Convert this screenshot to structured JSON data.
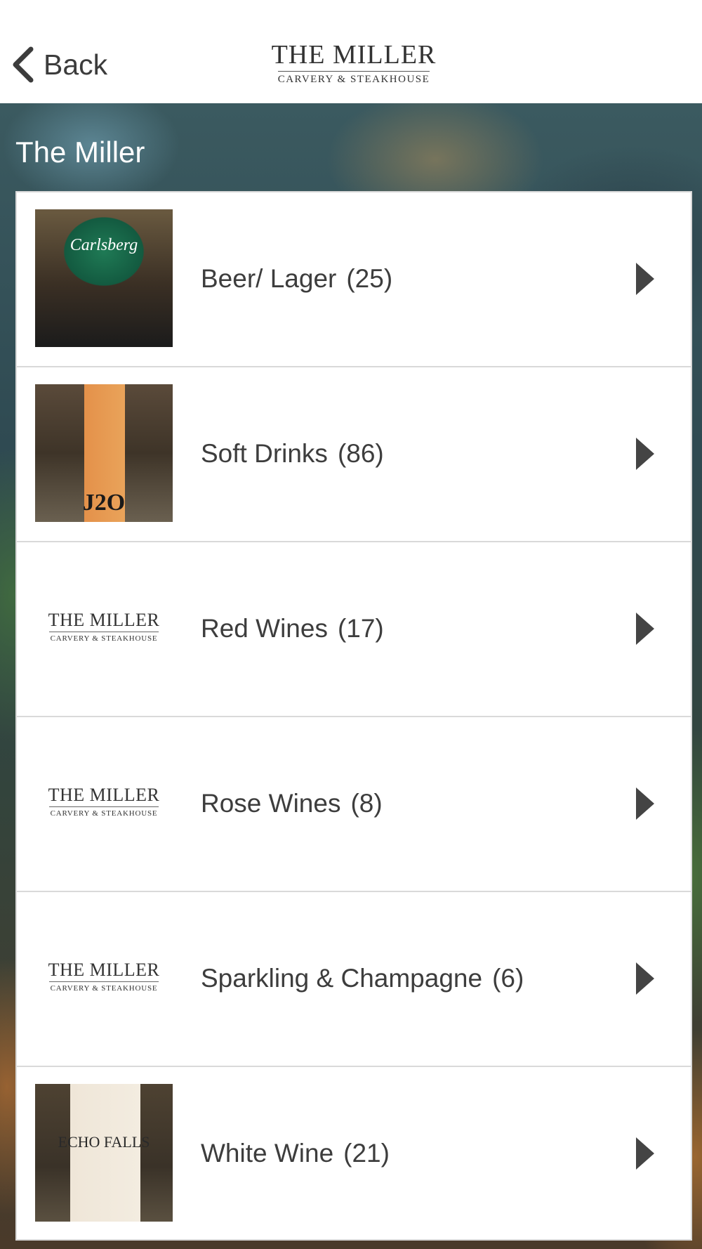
{
  "header": {
    "back_label": "Back",
    "logo_title": "THE MILLER",
    "logo_subtitle": "CARVERY & STEAKHOUSE"
  },
  "section_title": "The Miller",
  "categories": [
    {
      "name": "Beer/ Lager",
      "count": "(25)",
      "thumbnail": "photo-carlsberg-tap"
    },
    {
      "name": "Soft Drinks",
      "count": "(86)",
      "thumbnail": "photo-j2o-bottle"
    },
    {
      "name": "Red Wines",
      "count": "(17)",
      "thumbnail": "logo"
    },
    {
      "name": "Rose Wines",
      "count": "(8)",
      "thumbnail": "logo"
    },
    {
      "name": "Sparkling & Champagne",
      "count": "(6)",
      "thumbnail": "logo"
    },
    {
      "name": "White Wine",
      "count": "(21)",
      "thumbnail": "photo-echo-falls-bottle"
    }
  ],
  "colors": {
    "text": "#3d3d3d",
    "row_border": "#d9d9d9",
    "chevron": "#444444"
  }
}
